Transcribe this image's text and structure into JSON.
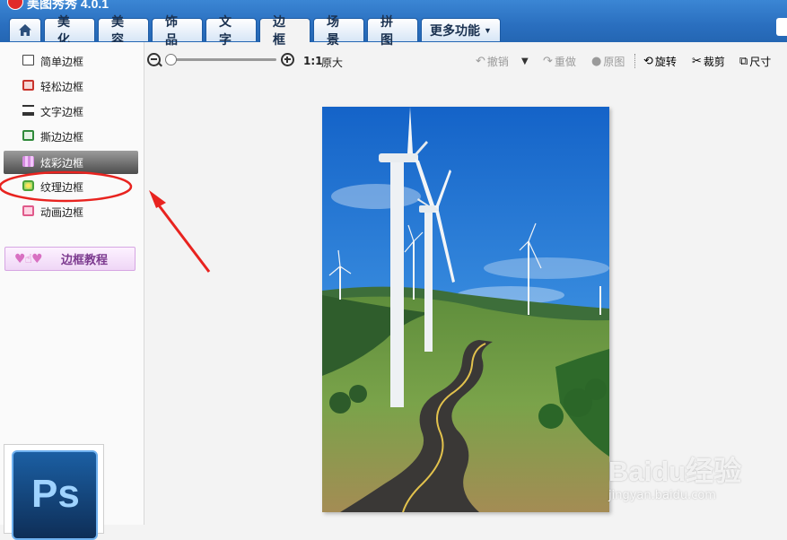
{
  "app": {
    "title": "美图秀秀 4.0.1"
  },
  "tabs": [
    {
      "label": "美化"
    },
    {
      "label": "美容"
    },
    {
      "label": "饰品"
    },
    {
      "label": "文字"
    },
    {
      "label": "边框"
    },
    {
      "label": "场景"
    },
    {
      "label": "拼图"
    },
    {
      "label": "更多功能"
    }
  ],
  "sidebar": {
    "items": [
      {
        "label": "简单边框",
        "icon": "simple-frame-icon"
      },
      {
        "label": "轻松边框",
        "icon": "easy-frame-icon"
      },
      {
        "label": "文字边框",
        "icon": "text-frame-icon"
      },
      {
        "label": "撕边边框",
        "icon": "torn-edge-frame-icon"
      },
      {
        "label": "炫彩边框",
        "icon": "colorful-frame-icon"
      },
      {
        "label": "纹理边框",
        "icon": "texture-frame-icon"
      },
      {
        "label": "动画边框",
        "icon": "animation-frame-icon"
      }
    ],
    "selected_index": 4,
    "tutorial_label": "边框教程"
  },
  "toolbar": {
    "ratio_label": "1:1",
    "original_size_label": "原大",
    "undo_label": "撤销",
    "redo_label": "重做",
    "original_image_label": "原图",
    "rotate_label": "旋转",
    "crop_label": "裁剪",
    "size_label": "尺寸"
  },
  "ps_icon_text": "Ps",
  "watermark": {
    "logo": "Baidu经验",
    "url": "jingyan.baidu.com"
  },
  "colors": {
    "titlebar": "#2a6fbf",
    "annotation_red": "#e8231f",
    "selected_item": "#5a5a5a"
  }
}
